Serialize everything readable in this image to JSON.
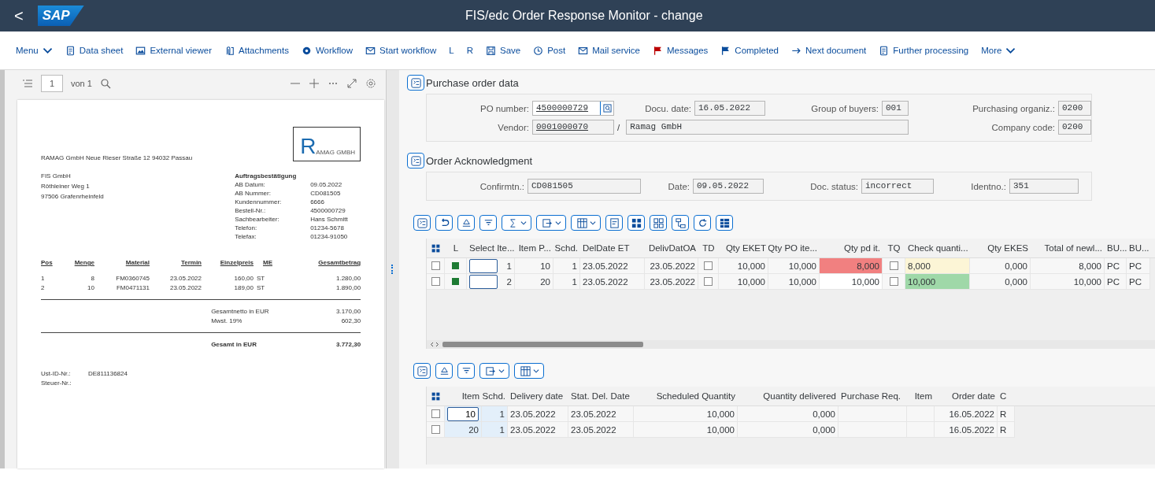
{
  "header": {
    "back": "<",
    "logo": "SAP",
    "title": "FIS/edc Order Response Monitor - change"
  },
  "toolbar": [
    {
      "label": "Menu",
      "kind": "text",
      "dropdown": true
    },
    {
      "label": "Data sheet",
      "kind": "sheet",
      "dropdown": false
    },
    {
      "label": "External viewer",
      "kind": "image",
      "dropdown": false
    },
    {
      "label": "Attachments",
      "kind": "attach",
      "dropdown": false
    },
    {
      "label": "Workflow",
      "kind": "gear",
      "dropdown": false
    },
    {
      "label": "Start workflow",
      "kind": "mail",
      "dropdown": false
    },
    {
      "label": "L",
      "kind": "text",
      "dropdown": false
    },
    {
      "label": "R",
      "kind": "text",
      "dropdown": false
    },
    {
      "label": "Save",
      "kind": "save",
      "dropdown": false
    },
    {
      "label": "Post",
      "kind": "clock",
      "dropdown": false
    },
    {
      "label": "Mail service",
      "kind": "mail",
      "dropdown": false
    },
    {
      "label": "Messages",
      "kind": "flag",
      "color": "#bb0000",
      "dropdown": false
    },
    {
      "label": "Completed",
      "kind": "flag",
      "color": "#0a4c9c",
      "dropdown": false
    },
    {
      "label": "Next document",
      "kind": "arrow",
      "dropdown": false
    },
    {
      "label": "Further processing",
      "kind": "sheet",
      "dropdown": false
    },
    {
      "label": "More",
      "kind": "text",
      "dropdown": true
    }
  ],
  "viewer": {
    "page": "1",
    "page_of": "von 1",
    "document": {
      "sender": "RAMAG GmbH Neue Rieser Straße 12 94032 Passau",
      "logo_letter": "R",
      "logo_text": "AMAG GMBH",
      "address": [
        "FIS GmbH",
        "Röthleiner Weg 1",
        "97506 Grafenrheinfeld"
      ],
      "info_title": "Auftragsbestätigung",
      "info": [
        {
          "label": "AB Datum:",
          "value": "09.05.2022"
        },
        {
          "label": "AB Nummer:",
          "value": "CD081505"
        },
        {
          "label": "Kundennummer:",
          "value": "6666"
        },
        {
          "label": "Bestell-Nr.:",
          "value": "4500000729"
        },
        {
          "label": "Sachbearbeiter:",
          "value": "Hans Schmitt"
        },
        {
          "label": "Telefon:",
          "value": "01234-5678"
        },
        {
          "label": "Telefax:",
          "value": "01234-91050"
        }
      ],
      "columns": [
        "Pos",
        "Menge",
        "Material",
        "Termin",
        "Einzelpreis",
        "ME",
        "Gesamtbetrag"
      ],
      "rows": [
        [
          "1",
          "8",
          "FM0360745",
          "23.05.2022",
          "160,00",
          "ST",
          "1.280,00"
        ],
        [
          "2",
          "10",
          "FM0471131",
          "23.05.2022",
          "189,00",
          "ST",
          "1.890,00"
        ]
      ],
      "totals": [
        {
          "label": "Gesamtnetto in EUR",
          "value": "3.170,00"
        },
        {
          "label": "Mwst. 19%",
          "value": "602,30"
        }
      ],
      "grand_total": {
        "label": "Gesamt in EUR",
        "value": "3.772,30"
      },
      "footer": [
        {
          "label": "Ust-ID-Nr.:",
          "value": "DE811136824"
        },
        {
          "label": "Steuer-Nr.:"
        }
      ]
    }
  },
  "po_data": {
    "title": "Purchase order data",
    "fields": [
      {
        "label": "PO number:",
        "value": "4500000729",
        "kind": "search"
      },
      {
        "label": "Docu. date:",
        "value": "16.05.2022"
      },
      {
        "label": "Group of buyers:",
        "value": "001"
      },
      {
        "label": "Purchasing organiz.:",
        "value": "0200"
      },
      {
        "label": "Vendor:",
        "value": "0001000070",
        "kind": "link"
      },
      {
        "label": "/",
        "value": "Ramag GmbH",
        "kind": "description"
      },
      {
        "label": "Company code:",
        "value": "0200"
      }
    ]
  },
  "order_ack": {
    "title": "Order Acknowledgment",
    "fields": [
      {
        "label": "Confirmtn.:",
        "value": "CD081505"
      },
      {
        "label": "Date:",
        "value": "09.05.2022"
      },
      {
        "label": "Doc. status:",
        "value": "incorrect"
      },
      {
        "label": "Identno.:",
        "value": "351"
      }
    ]
  },
  "items_toolbar": [
    {
      "kind": "collapse"
    },
    {
      "kind": "undo"
    },
    {
      "kind": "sort"
    },
    {
      "kind": "filter"
    },
    {
      "kind": "sum",
      "dropdown": true
    },
    {
      "kind": "export",
      "dropdown": true
    },
    {
      "kind": "layout",
      "dropdown": true
    },
    {
      "kind": "details"
    },
    {
      "kind": "select-all"
    },
    {
      "kind": "deselect-all"
    },
    {
      "kind": "tree"
    },
    {
      "kind": "refresh"
    },
    {
      "kind": "table"
    }
  ],
  "items_table": {
    "columns": [
      {
        "kind": "selector"
      },
      {
        "label": "L",
        "kind": "indicator"
      },
      {
        "label": "Select Ite...",
        "kind": "text"
      },
      {
        "label": "Item P...",
        "kind": "numeric"
      },
      {
        "label": "Schd.",
        "kind": "numeric"
      },
      {
        "label": "DelDate ET",
        "kind": "text"
      },
      {
        "label": "DelivDatOA",
        "kind": "numeric"
      },
      {
        "label": "TD",
        "kind": "indicator"
      },
      {
        "label": "Qty EKET",
        "kind": "numeric"
      },
      {
        "label": "Qty PO ite...",
        "kind": "numeric"
      },
      {
        "label": "Qty pd it.",
        "kind": "numeric"
      },
      {
        "label": "TQ",
        "kind": "indicator"
      },
      {
        "label": "Check quanti...",
        "kind": "text"
      },
      {
        "label": "Qty EKES",
        "kind": "numeric"
      },
      {
        "label": "Total of newl...",
        "kind": "numeric"
      },
      {
        "label": "BU...",
        "kind": "text"
      },
      {
        "label": "BU...",
        "kind": "text"
      }
    ],
    "rows": [
      {
        "cells": [
          {
            "kind": "checkbox",
            "checked": false
          },
          {
            "kind": "light",
            "color": "#1e7b34"
          },
          {
            "kind": "input",
            "text": "",
            "number": "1"
          },
          {
            "kind": "text",
            "text": "10"
          },
          {
            "kind": "text",
            "text": "1"
          },
          {
            "kind": "text",
            "text": "23.05.2022"
          },
          {
            "kind": "text",
            "text": "23.05.2022"
          },
          {
            "kind": "checkbox",
            "checked": false
          },
          {
            "kind": "text",
            "text": "10,000"
          },
          {
            "kind": "text",
            "text": "10,000"
          },
          {
            "kind": "error",
            "text": "8,000"
          },
          {
            "kind": "checkbox",
            "checked": false
          },
          {
            "kind": "warning",
            "text": "8,000"
          },
          {
            "kind": "text",
            "text": "0,000"
          },
          {
            "kind": "text",
            "text": "8,000"
          },
          {
            "kind": "text",
            "text": "PC"
          },
          {
            "kind": "text",
            "text": "PC"
          }
        ]
      },
      {
        "cells": [
          {
            "kind": "checkbox",
            "checked": false
          },
          {
            "kind": "light",
            "color": "#1e7b34"
          },
          {
            "kind": "input",
            "text": "",
            "number": "2"
          },
          {
            "kind": "text",
            "text": "20"
          },
          {
            "kind": "text",
            "text": "1"
          },
          {
            "kind": "text",
            "text": "23.05.2022"
          },
          {
            "kind": "text",
            "text": "23.05.2022"
          },
          {
            "kind": "checkbox",
            "checked": false
          },
          {
            "kind": "text",
            "text": "10,000"
          },
          {
            "kind": "text",
            "text": "10,000"
          },
          {
            "kind": "editable",
            "text": "10,000"
          },
          {
            "kind": "checkbox",
            "checked": false
          },
          {
            "kind": "success",
            "text": "10,000"
          },
          {
            "kind": "text",
            "text": "0,000"
          },
          {
            "kind": "text",
            "text": "10,000"
          },
          {
            "kind": "text",
            "text": "PC"
          },
          {
            "kind": "text",
            "text": "PC"
          }
        ]
      }
    ]
  },
  "schedule_toolbar": [
    {
      "kind": "collapse"
    },
    {
      "kind": "sort"
    },
    {
      "kind": "filter"
    },
    {
      "kind": "export",
      "dropdown": true
    },
    {
      "kind": "layout",
      "dropdown": true
    }
  ],
  "schedule_table": {
    "columns": [
      {
        "kind": "selector"
      },
      {
        "label": "Item",
        "kind": "numeric"
      },
      {
        "label": "Schd.",
        "kind": "numeric"
      },
      {
        "label": "Delivery date",
        "kind": "text"
      },
      {
        "label": "Stat. Del. Date",
        "kind": "text"
      },
      {
        "label": "Scheduled Quantity",
        "kind": "numeric"
      },
      {
        "label": "Quantity delivered",
        "kind": "numeric"
      },
      {
        "label": "Purchase Req.",
        "kind": "text"
      },
      {
        "label": "Item",
        "kind": "numeric"
      },
      {
        "label": "Order date",
        "kind": "numeric"
      },
      {
        "label": "C",
        "kind": "text"
      }
    ],
    "rows": [
      {
        "cells": [
          {
            "kind": "checkbox",
            "checked": false
          },
          {
            "kind": "input",
            "text": "10"
          },
          {
            "kind": "key",
            "text": "1"
          },
          {
            "kind": "text",
            "text": "23.05.2022"
          },
          {
            "kind": "text",
            "text": "23.05.2022"
          },
          {
            "kind": "text",
            "text": "10,000"
          },
          {
            "kind": "text",
            "text": "0,000"
          },
          {
            "kind": "empty"
          },
          {
            "kind": "empty"
          },
          {
            "kind": "text",
            "text": "16.05.2022"
          },
          {
            "kind": "text",
            "text": "R"
          }
        ]
      },
      {
        "cells": [
          {
            "kind": "checkbox",
            "checked": false
          },
          {
            "kind": "key",
            "text": "20"
          },
          {
            "kind": "key",
            "text": "1"
          },
          {
            "kind": "text",
            "text": "23.05.2022"
          },
          {
            "kind": "text",
            "text": "23.05.2022"
          },
          {
            "kind": "text",
            "text": "10,000"
          },
          {
            "kind": "text",
            "text": "0,000"
          },
          {
            "kind": "empty"
          },
          {
            "kind": "empty"
          },
          {
            "kind": "text",
            "text": "16.05.2022"
          },
          {
            "kind": "text",
            "text": "R"
          }
        ]
      }
    ]
  }
}
